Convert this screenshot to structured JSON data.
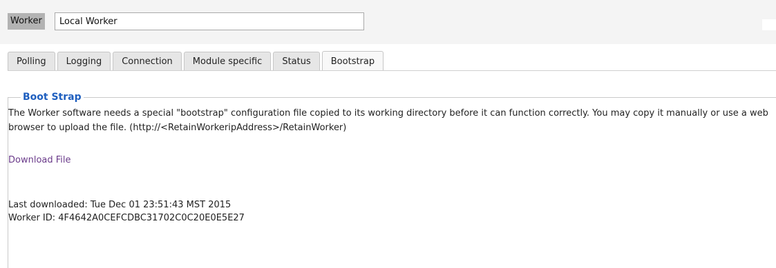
{
  "header": {
    "worker_label": "Worker",
    "worker_value": "Local Worker"
  },
  "tabs": [
    {
      "label": "Polling",
      "active": false
    },
    {
      "label": "Logging",
      "active": false
    },
    {
      "label": "Connection",
      "active": false
    },
    {
      "label": "Module specific",
      "active": false
    },
    {
      "label": "Status",
      "active": false
    },
    {
      "label": "Bootstrap",
      "active": true
    }
  ],
  "bootstrap": {
    "legend": "Boot Strap",
    "description": "The Worker software needs a special \"bootstrap\" configuration file copied to its working directory before it can function correctly. You may copy it manually or use a web browser to upload the file. (http://<RetainWorkeripAddress>/RetainWorker)",
    "download_label": "Download File",
    "last_downloaded": "Last downloaded: Tue Dec 01 23:51:43 MST 2015",
    "worker_id": "Worker ID: 4F4642A0CEFCDBC31702C0C20E0E5E27"
  }
}
